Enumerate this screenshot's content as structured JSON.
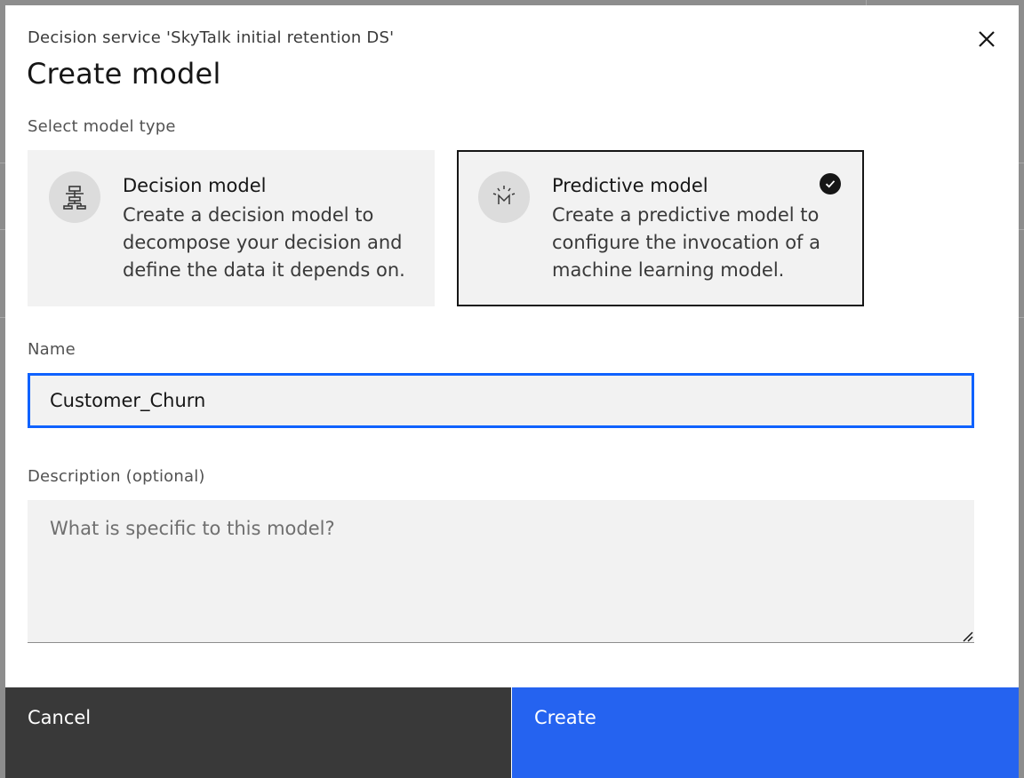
{
  "modal": {
    "label": "Decision service 'SkyTalk initial retention DS'",
    "heading": "Create model",
    "close_icon": "close-icon"
  },
  "model_type": {
    "label": "Select model type",
    "options": [
      {
        "title": "Decision model",
        "description": "Create a decision model to decompose your decision and define the data it depends on.",
        "icon": "decision-tree-icon",
        "selected": false
      },
      {
        "title": "Predictive model",
        "description": "Create a predictive model to configure the invocation of a machine learning model.",
        "icon": "machine-learning-model-icon",
        "selected": true
      }
    ]
  },
  "name_field": {
    "label": "Name",
    "value": "Customer_Churn"
  },
  "description_field": {
    "label": "Description (optional)",
    "placeholder": "What is specific to this model?",
    "value": ""
  },
  "footer": {
    "cancel_label": "Cancel",
    "create_label": "Create"
  },
  "colors": {
    "primary": "#0f62fe",
    "create_button": "#2563f0",
    "cancel_button": "#393939",
    "tile_background": "#f2f2f2"
  }
}
